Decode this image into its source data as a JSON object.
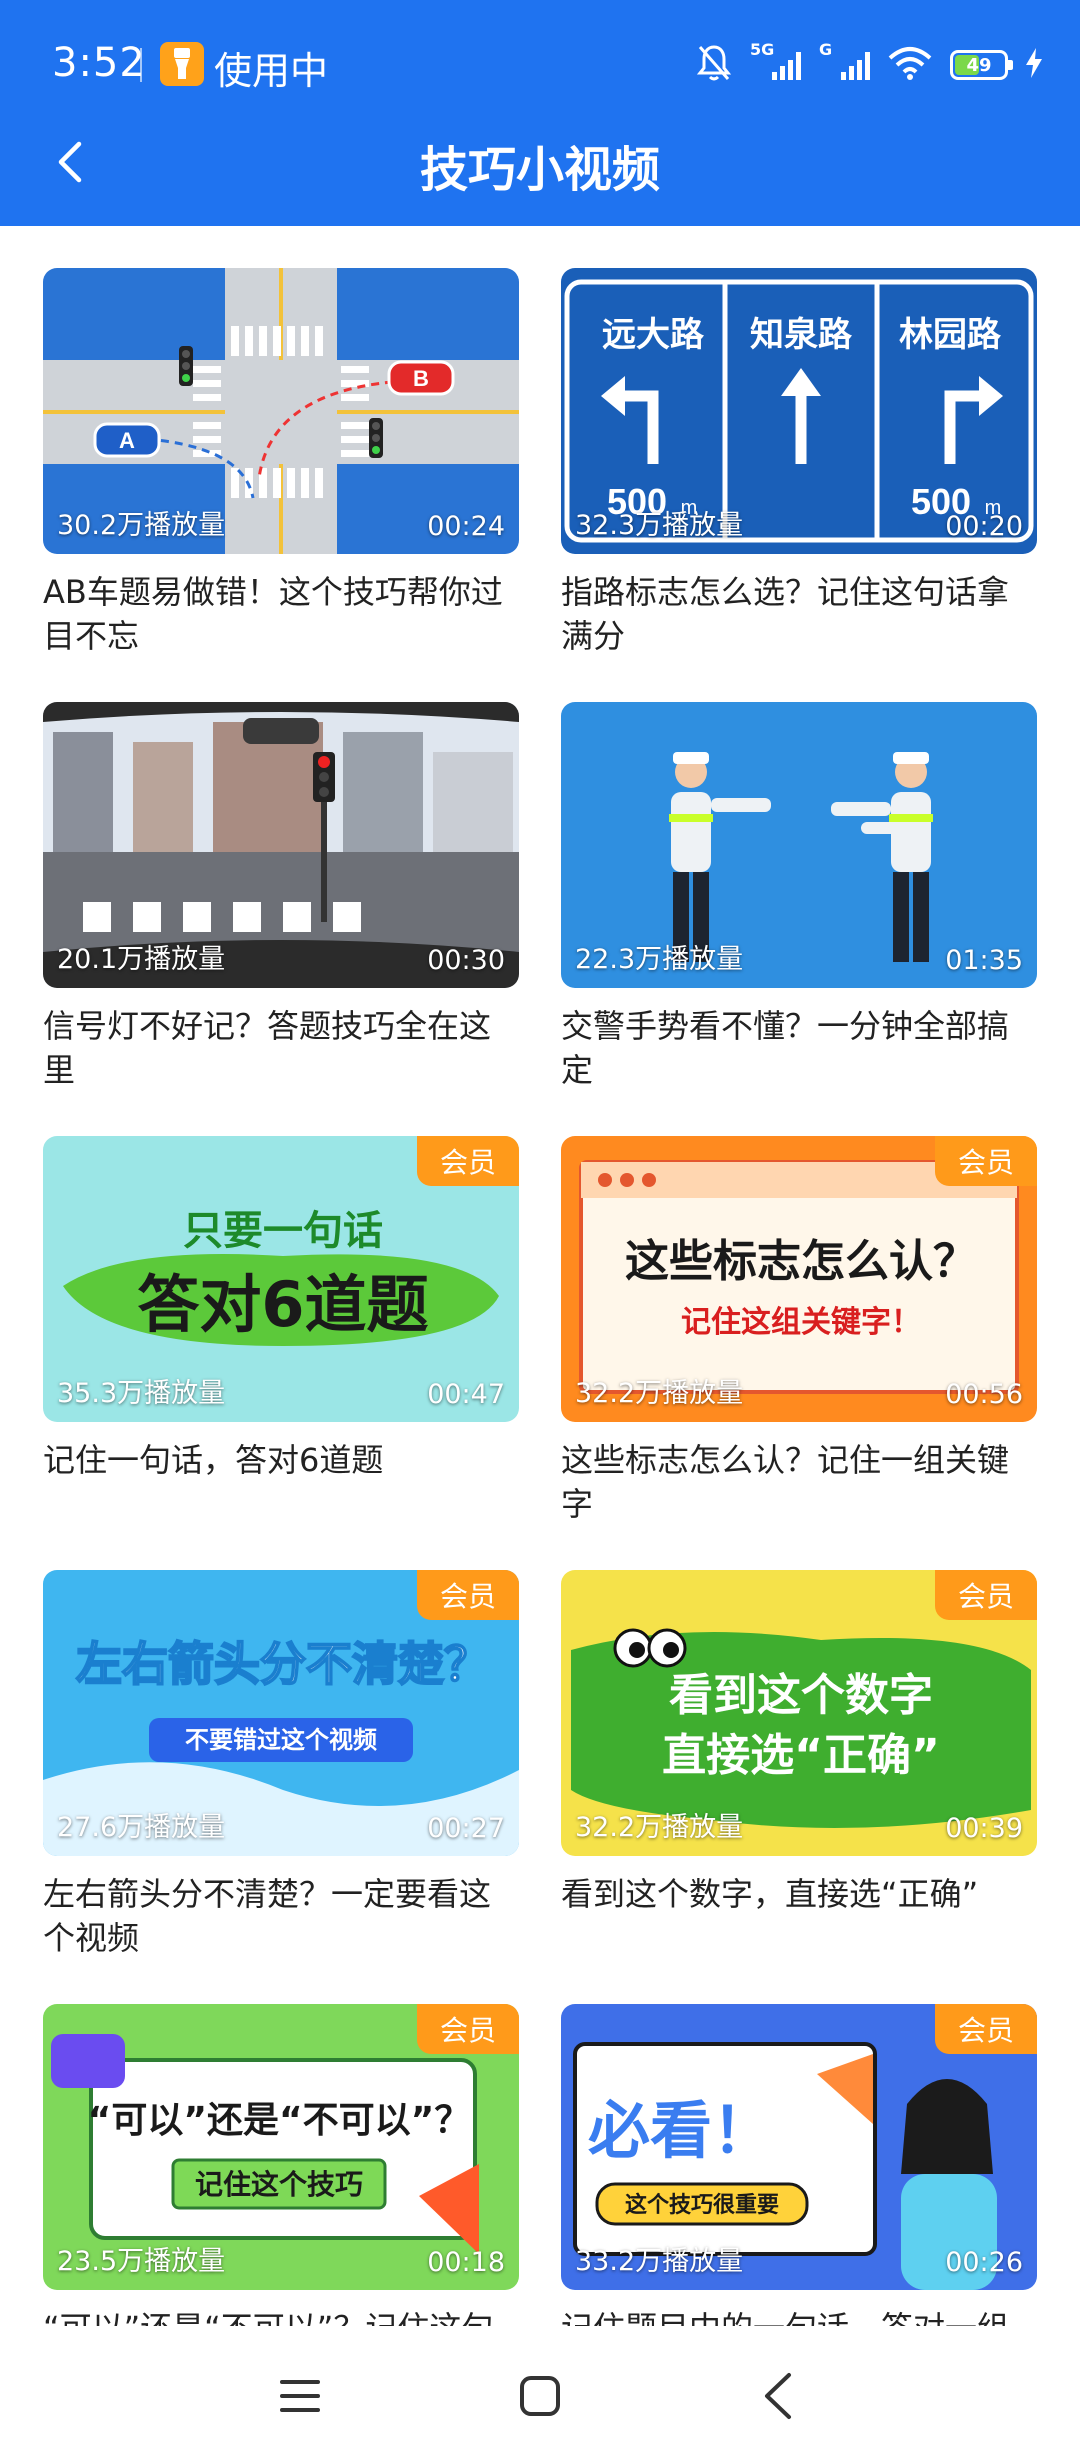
{
  "status_bar": {
    "time": "3:52",
    "app_in_use": "使用中",
    "signal1_label": "5G",
    "signal2_label": "G",
    "battery": "49",
    "battery_level": 0.49
  },
  "header": {
    "title": "技巧小视频",
    "back_icon": "chevron-left-icon",
    "background": "#1f73f0"
  },
  "videos": [
    {
      "plays": "30.2万播放量",
      "duration": "00:24",
      "title": "AB车题易做错！这个技巧帮你过目不忘",
      "vip": ""
    },
    {
      "plays": "32.3万播放量",
      "duration": "00:20",
      "title": "指路标志怎么选？记住这句话拿满分",
      "vip": "",
      "sign": {
        "left": "远大路",
        "center": "知泉路",
        "right": "林园路",
        "dist_left": "500",
        "dist_right": "500",
        "unit": "m"
      }
    },
    {
      "plays": "20.1万播放量",
      "duration": "00:30",
      "title": "信号灯不好记？答题技巧全在这里",
      "vip": ""
    },
    {
      "plays": "22.3万播放量",
      "duration": "01:35",
      "title": "交警手势看不懂？一分钟全部搞定",
      "vip": ""
    },
    {
      "plays": "35.3万播放量",
      "duration": "00:47",
      "title": "记住一句话，答对6道题",
      "vip": "会员",
      "art_line1": "只要一句话",
      "art_line2": "答对6道题"
    },
    {
      "plays": "32.2万播放量",
      "duration": "00:56",
      "title": "这些标志怎么认？记住一组关键字",
      "vip": "会员",
      "art_line1": "这些标志怎么认？",
      "art_line2": "记住这组关键字！"
    },
    {
      "plays": "27.6万播放量",
      "duration": "00:27",
      "title": "左右箭头分不清楚？一定要看这个视频",
      "vip": "会员",
      "art_line1": "左右箭头分不清楚？",
      "art_line2": "不要错过这个视频"
    },
    {
      "plays": "32.2万播放量",
      "duration": "00:39",
      "title": "看到这个数字，直接选“正确”",
      "vip": "会员",
      "art_line1": "看到这个数字",
      "art_line2": "直接选“正确”"
    },
    {
      "plays": "23.5万播放量",
      "duration": "00:18",
      "title": "“可以”还是“不可以”？记住这句",
      "vip": "会员",
      "art_line1": "“可以”还是“不可以”？",
      "art_line2": "记住这个技巧"
    },
    {
      "plays": "33.2万播放量",
      "duration": "00:26",
      "title": "记住题目中的一句话，答对一组",
      "vip": "会员",
      "art_line1": "必看！",
      "art_line2": "这个技巧很重要"
    }
  ],
  "car_labels": {
    "a": "A",
    "b": "B"
  },
  "nav": {
    "menu_icon": "menu-icon",
    "home_icon": "home-square-icon",
    "back_icon": "back-triangle-icon"
  }
}
